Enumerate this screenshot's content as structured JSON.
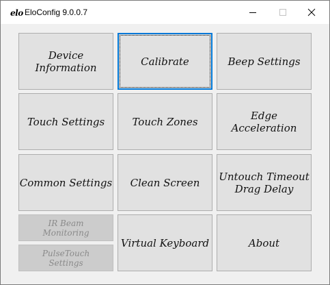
{
  "window": {
    "logo_text": "elo",
    "title": "EloConfig 9.0.0.7",
    "controls": {
      "minimize": "minimize",
      "maximize": "maximize",
      "close": "close"
    }
  },
  "buttons": {
    "device_information": "Device Information",
    "calibrate": "Calibrate",
    "beep_settings": "Beep Settings",
    "touch_settings": "Touch Settings",
    "touch_zones": "Touch Zones",
    "edge_acceleration": "Edge Acceleration",
    "common_settings": "Common Settings",
    "clean_screen": "Clean Screen",
    "untouch_timeout": "Untouch Timeout\nDrag Delay",
    "ir_beam_monitoring": "IR Beam\nMonitoring",
    "pulsetouch_settings": "PulseTouch\nSettings",
    "virtual_keyboard": "Virtual Keyboard",
    "about": "About"
  },
  "colors": {
    "focus_border": "#0078d7",
    "button_bg": "#e1e1e1",
    "disabled_bg": "#cccccc"
  }
}
